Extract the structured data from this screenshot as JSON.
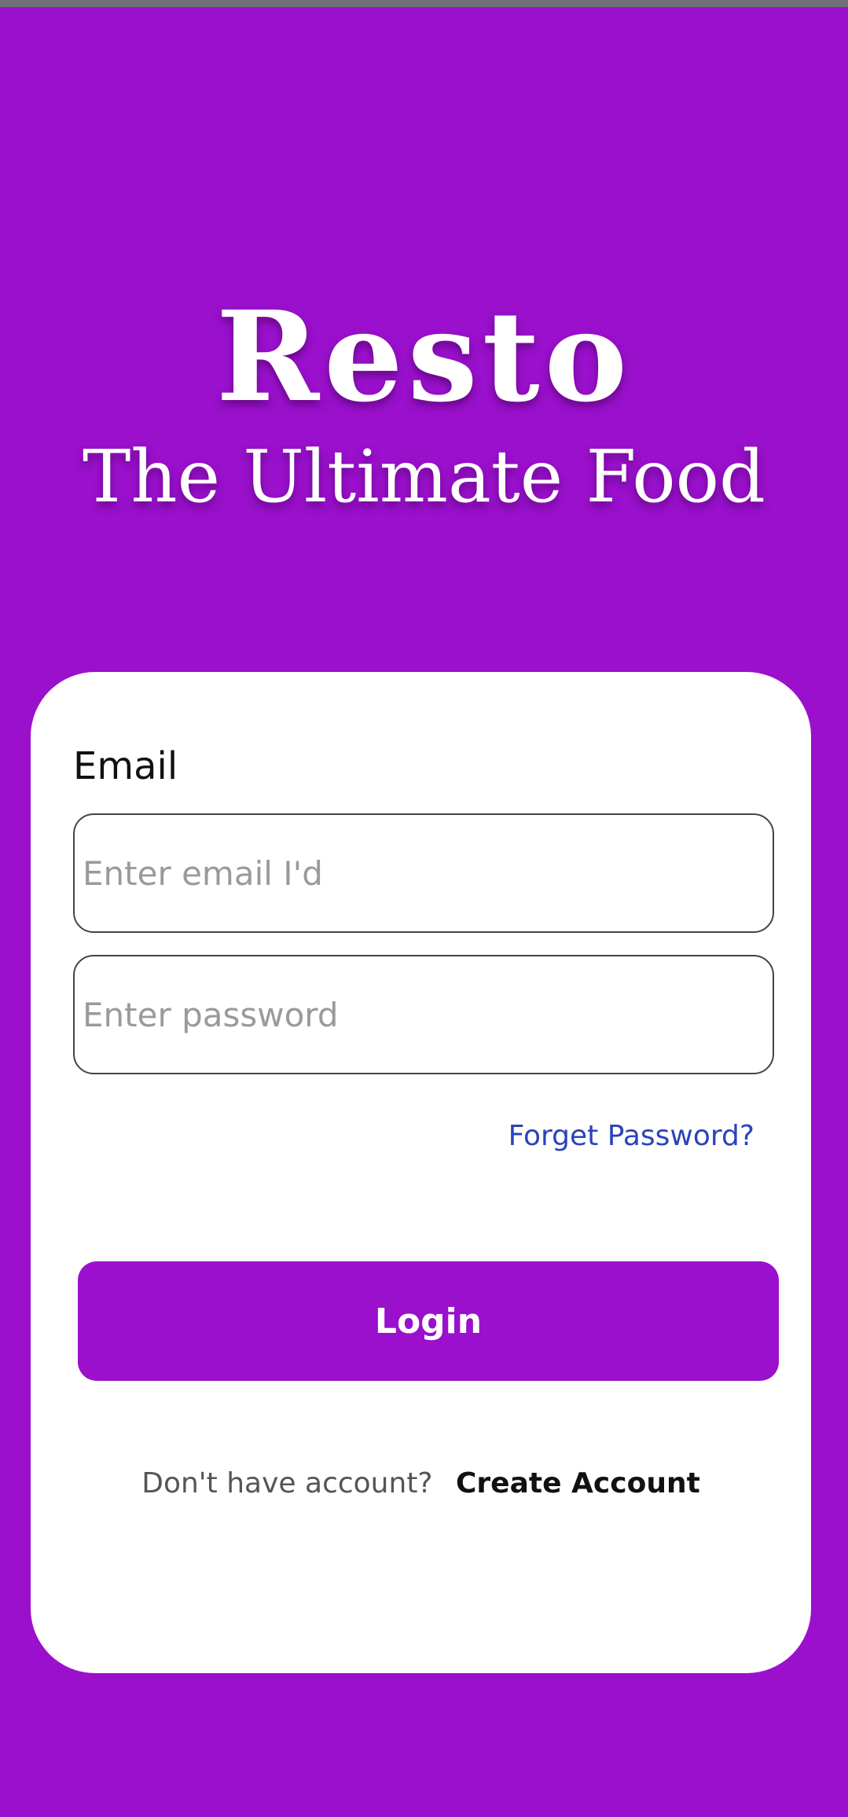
{
  "brand": {
    "title": "Resto",
    "subtitle": "The Ultimate Food"
  },
  "form": {
    "email_label": "Email",
    "email_placeholder": "Enter email I'd",
    "password_placeholder": "Enter password",
    "forgot_label": "Forget Password?",
    "login_label": "Login",
    "signup_prompt": "Don't have account?",
    "signup_link": "Create Account"
  },
  "colors": {
    "primary": "#9a10cc",
    "card": "#ffffff",
    "link": "#2a44b8"
  }
}
